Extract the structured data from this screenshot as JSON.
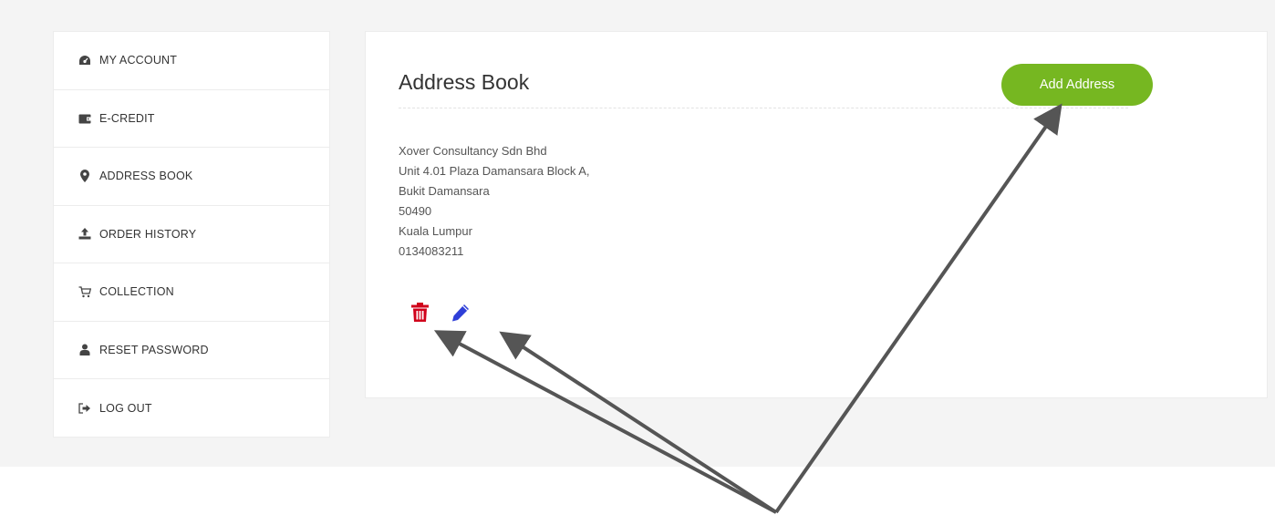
{
  "sidebar": {
    "items": [
      {
        "label": "MY ACCOUNT",
        "icon": "dashboard-icon"
      },
      {
        "label": "E-CREDIT",
        "icon": "wallet-icon"
      },
      {
        "label": "ADDRESS BOOK",
        "icon": "map-marker-icon"
      },
      {
        "label": "ORDER HISTORY",
        "icon": "upload-icon"
      },
      {
        "label": "COLLECTION",
        "icon": "cart-icon"
      },
      {
        "label": "RESET PASSWORD",
        "icon": "user-icon"
      },
      {
        "label": "LOG OUT",
        "icon": "sign-out-icon"
      }
    ]
  },
  "main": {
    "title": "Address Book",
    "add_button_label": "Add Address",
    "address": {
      "line1": "Xover Consultancy Sdn Bhd",
      "line2": "Unit 4.01 Plaza Damansara Block A,",
      "line3": "Bukit Damansara",
      "postcode": "50490",
      "city": "Kuala Lumpur",
      "phone": "0134083211"
    },
    "actions": {
      "delete_icon": "trash-icon",
      "edit_icon": "pencil-icon"
    }
  },
  "colors": {
    "accent_green": "#76b721",
    "delete_red": "#d0021b",
    "edit_blue": "#2f3fd8",
    "annotation_arrow": "#555555",
    "page_background": "#f4f4f4"
  }
}
